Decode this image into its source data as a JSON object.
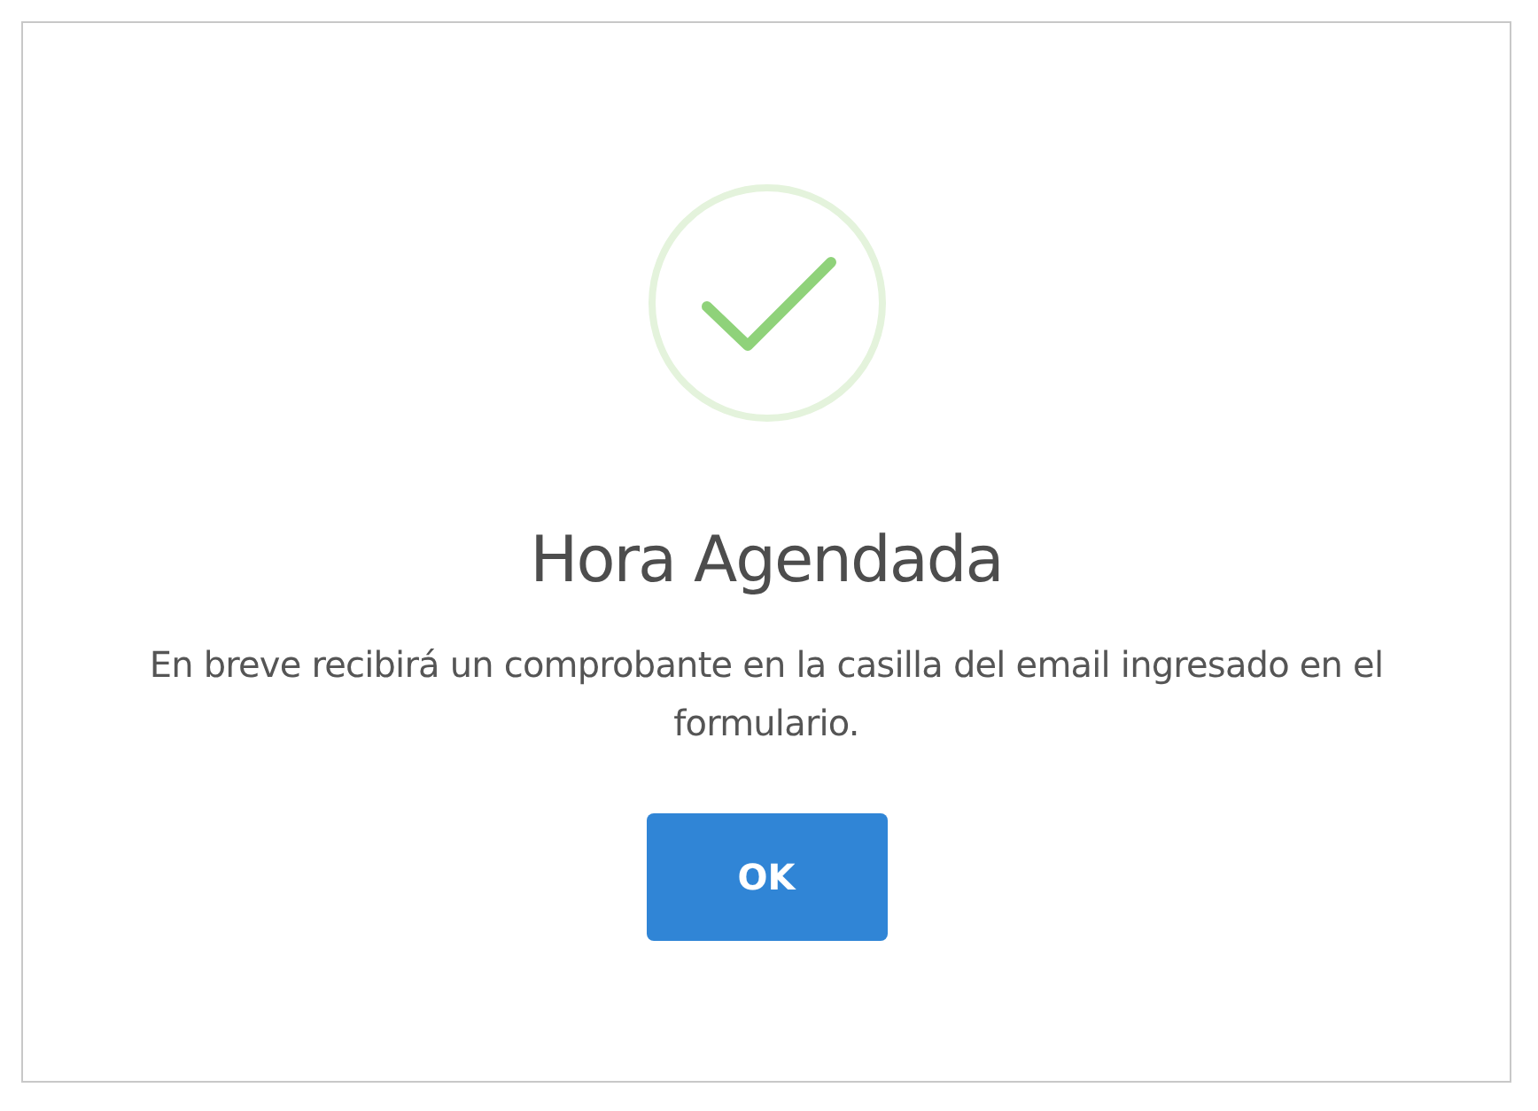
{
  "dialog": {
    "title": "Hora Agendada",
    "message": "En breve recibirá un comprobante en la casilla del email ingresado en el formulario.",
    "button": "OK"
  }
}
